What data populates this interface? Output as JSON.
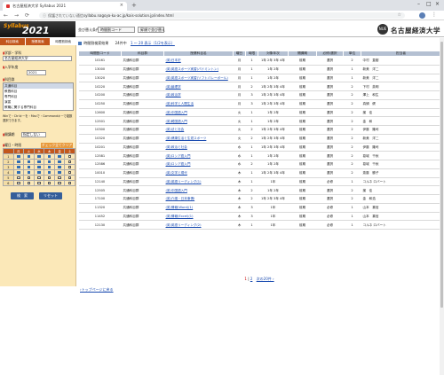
{
  "browser": {
    "tab_title": "名古屋経済大学 Syllabus 2021",
    "tab_close": "×",
    "new_tab": "+",
    "minimize": "–",
    "maximize": "□",
    "close": "×",
    "back": "←",
    "forward": "→",
    "reload": "⟳",
    "insecure_label": "保護されていない通信",
    "url": "syllabu.nagoya-ku-ac.jp/kais-solution.jp/index.html",
    "star": "☆",
    "menu": "⋮"
  },
  "header": {
    "logo_text": "Syllabus",
    "logo_year": "2021",
    "sort_label": "並び替え条件",
    "sort_value": "時間割コード",
    "sort_order": "昇順で並び替え",
    "univ_emblem": "NUE",
    "univ_name": "名古屋経済大学"
  },
  "sidebar": {
    "tabs": [
      "科目検索",
      "授業検索",
      "時間割検索"
    ],
    "faculty_label": "学部・学科",
    "faculty_value": "名古屋経済大学",
    "year_label": "入学年度",
    "year_value": "2021",
    "category_label": "科目群",
    "category_items": [
      "共通科目",
      "教養科目",
      "専門科目",
      "演習",
      "教職に関する専門科目"
    ],
    "note": "Winで・Ctrlキーを・Macで・Commandキーで複数選択できます。",
    "term_label": "開講期",
    "term_value": "指定しない",
    "weekday_label": "曜日・時限",
    "check_all": "チェック全てクリア",
    "days": [
      "月",
      "火",
      "水",
      "木",
      "金",
      "土"
    ],
    "periods": [
      "1",
      "2",
      "3",
      "4",
      "5",
      "6"
    ],
    "search_button": "検　索",
    "reset_button": "リセット"
  },
  "main": {
    "result_title": "時間割検索結果",
    "result_count": "24件中",
    "result_range": "1 ～ 20 表示（1/2を表示）",
    "columns": [
      "時間割コード",
      "科目群",
      "授業科目名",
      "曜日",
      "時限",
      "対象年次",
      "開講期",
      "必修/選択",
      "単位",
      "担当者"
    ],
    "rows": [
      [
        "10161",
        "共通科目群",
        "(英)日本史",
        "月",
        "1",
        "1年 2年 3年 4年",
        "前期",
        "選択",
        "2",
        "中村　直樹"
      ],
      [
        "13000",
        "共通科目群",
        "(英)英語スポーツ実習(バドミントン)",
        "月",
        "1",
        "1年 2年",
        "前期",
        "選択",
        "1",
        "新美　洋二"
      ],
      [
        "13020",
        "共通科目群",
        "(英)英語スポーツ実習(ソフトバレーボール)",
        "月",
        "1",
        "1年 2年",
        "前期",
        "選択",
        "1",
        "新美　洋二"
      ],
      [
        "10220",
        "共通科目群",
        "(英)論理学",
        "月",
        "2",
        "1年 2年 3年 4年",
        "前期",
        "選択",
        "2",
        "下村　英明"
      ],
      [
        "10200",
        "共通科目群",
        "(英)政治学",
        "月",
        "3",
        "1年 2年 3年 4年",
        "前期",
        "選択",
        "2",
        "澤上　和生"
      ],
      [
        "10250",
        "共通科目群",
        "(英)科学と人間生活",
        "月",
        "3",
        "1年 2年 3年 4年",
        "前期",
        "選択",
        "2",
        "真鍋　健"
      ],
      [
        "12600",
        "共通科目群",
        "(英)中国語入門",
        "火",
        "1",
        "1年 2年",
        "前期",
        "選択",
        "2",
        "謝　佳"
      ],
      [
        "12501",
        "共通科目群",
        "(英)韓国語入門",
        "火",
        "1",
        "1年 2年",
        "前期",
        "選択",
        "2",
        "金　和"
      ],
      [
        "10300",
        "共通科目群",
        "(英)法と社会",
        "火",
        "2",
        "1年 2年 3年 4年",
        "前期",
        "選択",
        "2",
        "伊藤　隆司"
      ],
      [
        "10320",
        "共通科目群",
        "(英)健康生活と生涯スポーツ",
        "火",
        "2",
        "1年 2年 3年 4年",
        "前期",
        "選択",
        "2",
        "新美　洋二"
      ],
      [
        "10201",
        "共通科目群",
        "(英)政治と社会",
        "水",
        "1",
        "1年 2年 3年 4年",
        "前期",
        "選択",
        "2",
        "伊藤　隆司"
      ],
      [
        "12581",
        "共通科目群",
        "(英)ロシア語入門",
        "水",
        "1",
        "1年 2年",
        "前期",
        "選択",
        "2",
        "葛城　千秋"
      ],
      [
        "12586",
        "共通科目群",
        "(英)ロシア語入門",
        "水",
        "2",
        "1年 2年",
        "前期",
        "選択",
        "2",
        "葛城　千秋"
      ],
      [
        "10010",
        "共通科目群",
        "(英)文学と現代",
        "木",
        "1",
        "1年 2年 3年 4年",
        "前期",
        "選択",
        "2",
        "斎藤　勝子"
      ],
      [
        "12140",
        "共通科目群",
        "(英)英語リーディング(1)",
        "木",
        "1",
        "1年",
        "前期",
        "必修",
        "1",
        "コルネ ロバート"
      ],
      [
        "12505",
        "共通科目群",
        "(英)中国語入門",
        "木",
        "2",
        "1年 2年",
        "前期",
        "選択",
        "2",
        "謝　佳"
      ],
      [
        "17100",
        "共通科目群",
        "(英)介護・日本事情I",
        "木",
        "2",
        "1年 2年 3年 4年",
        "前期",
        "選択",
        "2",
        "金　和浩"
      ],
      [
        "11320",
        "共通科目群",
        "(英)情報(Word)(1)",
        "木",
        "3",
        "1年",
        "前期",
        "必修",
        "1",
        "山本　喜信"
      ],
      [
        "11452",
        "共通科目群",
        "(英)情報(Excel)(1)",
        "木",
        "3",
        "1年",
        "前期",
        "必修",
        "1",
        "山本　喜信"
      ],
      [
        "12130",
        "共通科目群",
        "(英)英語リーディング(2)",
        "木",
        "1",
        "1年",
        "前期",
        "必修",
        "1",
        "コルネ ロバート"
      ]
    ],
    "pager_current": "1",
    "pager_next": "2",
    "pager_next_label": "次の20件 ›",
    "back_link": "›トップページに戻る"
  }
}
